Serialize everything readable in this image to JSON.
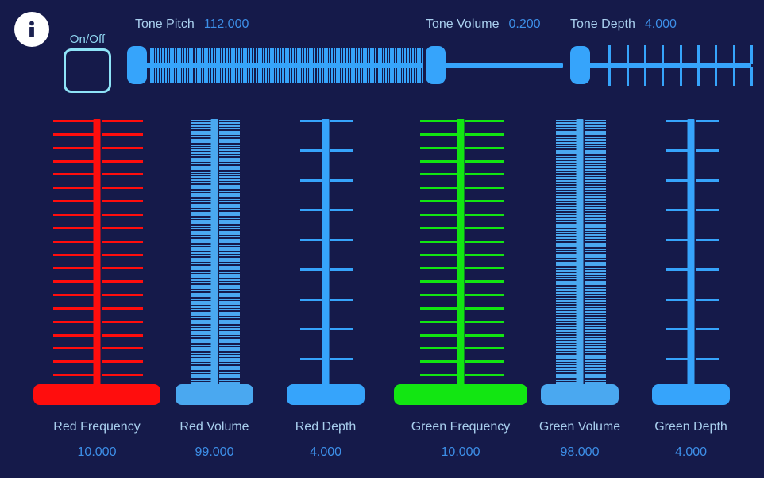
{
  "app": {
    "background_color": "#151a4a",
    "accent_blue": "#36a4fb",
    "label_blue": "#a9cfee",
    "value_blue": "#3d8fe8",
    "red": "#ff0d0d",
    "green": "#12e612",
    "cyan_outline": "#8ee3f7"
  },
  "header": {
    "info_icon": "info-icon",
    "onoff": {
      "label": "On/Off",
      "checked": false
    }
  },
  "tone_sliders": [
    {
      "id": "tone-pitch",
      "name": "Tone Pitch",
      "value": "112.000",
      "value_num": 112,
      "ticks": 112,
      "handle_pct": 0,
      "track_len": 349
    },
    {
      "id": "tone-volume",
      "name": "Tone Volume",
      "value": "0.200",
      "value_num": 0.2,
      "ticks": 0,
      "handle_pct": 0,
      "track_len": 150
    },
    {
      "id": "tone-depth",
      "name": "Tone Depth",
      "value": "4.000",
      "value_num": 4,
      "ticks": 9,
      "handle_pct": 0,
      "track_len": 205
    }
  ],
  "channel_sliders": [
    {
      "id": "red-frequency",
      "name": "Red Frequency",
      "value": "10.000",
      "value_num": 10,
      "color": "#ff0d0d",
      "ticks": 20,
      "tick_len": 104,
      "tick_thick": 3,
      "handle_w": 160
    },
    {
      "id": "red-volume",
      "name": "Red Volume",
      "value": "99.000",
      "value_num": 99,
      "color": "#4aa8f0",
      "ticks": 99,
      "tick_len": 52,
      "tick_thick": 2,
      "handle_w": 98
    },
    {
      "id": "red-depth",
      "name": "Red Depth",
      "value": "4.000",
      "value_num": 4,
      "color": "#36a4fb",
      "ticks": 9,
      "tick_len": 58,
      "tick_thick": 3,
      "handle_w": 98
    },
    {
      "id": "green-frequency",
      "name": "Green Frequency",
      "value": "10.000",
      "value_num": 10,
      "color": "#12e612",
      "ticks": 20,
      "tick_len": 96,
      "tick_thick": 3,
      "handle_w": 168
    },
    {
      "id": "green-volume",
      "name": "Green Volume",
      "value": "98.000",
      "value_num": 98,
      "color": "#4aa8f0",
      "ticks": 98,
      "tick_len": 54,
      "tick_thick": 2,
      "handle_w": 98
    },
    {
      "id": "green-depth",
      "name": "Green Depth",
      "value": "4.000",
      "value_num": 4,
      "color": "#36a4fb",
      "ticks": 9,
      "tick_len": 58,
      "tick_thick": 3,
      "handle_w": 98
    }
  ]
}
